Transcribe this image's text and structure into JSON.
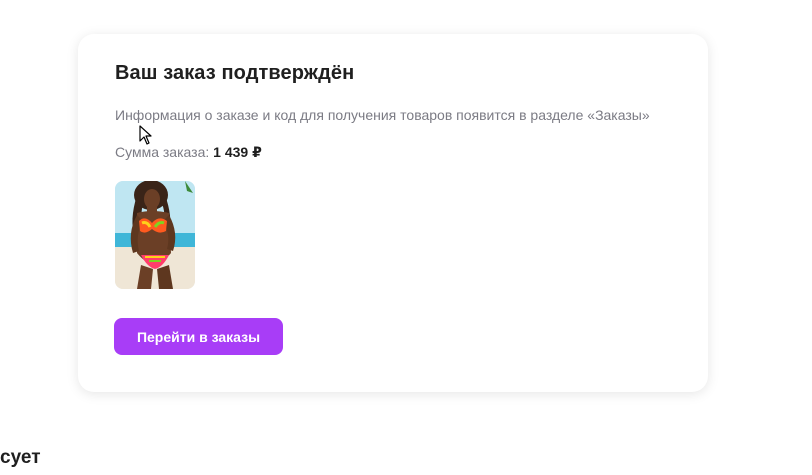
{
  "order_card": {
    "title": "Ваш заказ подтверждён",
    "info": "Информация о заказе и код для получения товаров появится в разделе «Заказы»",
    "sum_label": "Сумма заказа:",
    "sum_value": "1 439 ₽",
    "product_image": "swimsuit-product-photo",
    "button_label": "Перейти в заказы",
    "button_color": "#a83df7"
  },
  "footer": {
    "fragment": "сует"
  },
  "cursor": {
    "icon": "mouse-pointer-icon"
  }
}
